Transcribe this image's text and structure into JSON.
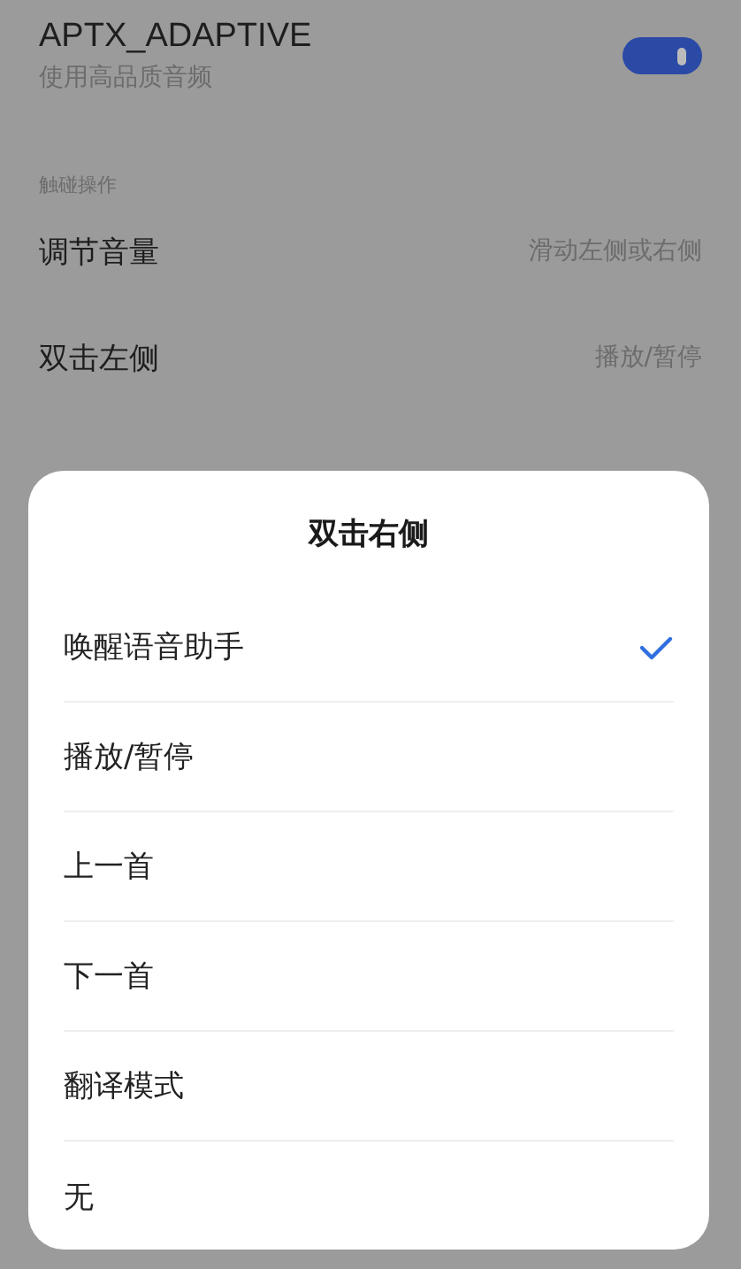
{
  "settings": {
    "codec": {
      "title": "APTX_ADAPTIVE",
      "subtitle": "使用高品质音频",
      "on": true
    },
    "section_header": "触碰操作",
    "rows": [
      {
        "label": "调节音量",
        "value": "滑动左侧或右侧"
      },
      {
        "label": "双击左侧",
        "value": "播放/暂停"
      }
    ]
  },
  "dialog": {
    "title": "双击右侧",
    "options": [
      {
        "label": "唤醒语音助手",
        "selected": true
      },
      {
        "label": "播放/暂停",
        "selected": false
      },
      {
        "label": "上一首",
        "selected": false
      },
      {
        "label": "下一首",
        "selected": false
      },
      {
        "label": "翻译模式",
        "selected": false
      },
      {
        "label": "无",
        "selected": false
      }
    ]
  }
}
